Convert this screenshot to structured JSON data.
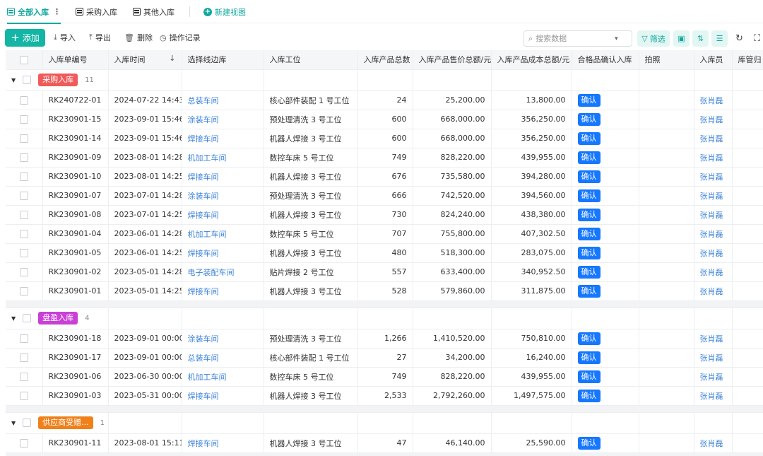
{
  "tabs": [
    {
      "label": "全部入库",
      "active": true
    },
    {
      "label": "采购入库",
      "active": false
    },
    {
      "label": "其他入库",
      "active": false
    }
  ],
  "new_view_label": "新建视图",
  "toolbar": {
    "add_label": "添加",
    "import_label": "导入",
    "export_label": "导出",
    "delete_label": "删除",
    "log_label": "操作记录",
    "search_placeholder": "搜索数据",
    "filter_label": "筛选"
  },
  "columns": [
    "入库单编号",
    "入库时间",
    "选择线边库",
    "入库工位",
    "入库产品总数",
    "入库产品售价总额/元",
    "入库产品成本总额/元",
    "合格品确认入库",
    "拍照",
    "入库员",
    "库管归"
  ],
  "confirm_label": "确认",
  "colors": {
    "accent": "#13a89e",
    "link": "#3b82d8",
    "confirm": "#1677ff"
  },
  "groups": [
    {
      "label": "采购入库",
      "color": "#f05a5a",
      "count": "11",
      "rows": [
        {
          "id": "RK240722-01",
          "time": "2024-07-22 14:43",
          "lib": "总装车间",
          "station": "核心部件装配 1 号工位",
          "qty": "24",
          "price": "25,200.00",
          "cost": "13,800.00",
          "staff": "张肖磊"
        },
        {
          "id": "RK230901-15",
          "time": "2023-09-01 15:46",
          "lib": "涂装车间",
          "station": "预处理清洗 3 号工位",
          "qty": "600",
          "price": "668,000.00",
          "cost": "356,250.00",
          "staff": "张肖磊"
        },
        {
          "id": "RK230901-14",
          "time": "2023-09-01 15:46",
          "lib": "焊接车间",
          "station": "机器人焊接 3 号工位",
          "qty": "600",
          "price": "668,000.00",
          "cost": "356,250.00",
          "staff": "张肖磊"
        },
        {
          "id": "RK230901-09",
          "time": "2023-08-01 14:28",
          "lib": "机加工车间",
          "station": "数控车床 5 号工位",
          "qty": "749",
          "price": "828,220.00",
          "cost": "439,955.00",
          "staff": "张肖磊"
        },
        {
          "id": "RK230901-10",
          "time": "2023-08-01 14:25",
          "lib": "焊接车间",
          "station": "机器人焊接 3 号工位",
          "qty": "676",
          "price": "735,580.00",
          "cost": "394,280.00",
          "staff": "张肖磊"
        },
        {
          "id": "RK230901-07",
          "time": "2023-07-01 14:28",
          "lib": "涂装车间",
          "station": "预处理清洗 3 号工位",
          "qty": "666",
          "price": "742,520.00",
          "cost": "394,560.00",
          "staff": "张肖磊"
        },
        {
          "id": "RK230901-08",
          "time": "2023-07-01 14:25",
          "lib": "焊接车间",
          "station": "机器人焊接 3 号工位",
          "qty": "730",
          "price": "824,240.00",
          "cost": "438,380.00",
          "staff": "张肖磊"
        },
        {
          "id": "RK230901-04",
          "time": "2023-06-01 14:28",
          "lib": "机加工车间",
          "station": "数控车床 5 号工位",
          "qty": "707",
          "price": "755,800.00",
          "cost": "407,302.50",
          "staff": "张肖磊"
        },
        {
          "id": "RK230901-05",
          "time": "2023-06-01 14:25",
          "lib": "焊接车间",
          "station": "机器人焊接 3 号工位",
          "qty": "480",
          "price": "518,300.00",
          "cost": "283,075.00",
          "staff": "张肖磊"
        },
        {
          "id": "RK230901-02",
          "time": "2023-05-01 14:28",
          "lib": "电子装配车间",
          "station": "贴片焊接 2 号工位",
          "qty": "557",
          "price": "633,400.00",
          "cost": "340,952.50",
          "staff": "张肖磊"
        },
        {
          "id": "RK230901-01",
          "time": "2023-05-01 14:25",
          "lib": "焊接车间",
          "station": "机器人焊接 3 号工位",
          "qty": "528",
          "price": "579,860.00",
          "cost": "311,875.00",
          "staff": "张肖磊"
        }
      ]
    },
    {
      "label": "盘盈入库",
      "color": "#c940d6",
      "count": "4",
      "rows": [
        {
          "id": "RK230901-18",
          "time": "2023-09-01 00:00",
          "lib": "涂装车间",
          "station": "预处理清洗 3 号工位",
          "qty": "1,266",
          "price": "1,410,520.00",
          "cost": "750,810.00",
          "staff": "张肖磊"
        },
        {
          "id": "RK230901-17",
          "time": "2023-09-01 00:00",
          "lib": "总装车间",
          "station": "核心部件装配 1 号工位",
          "qty": "27",
          "price": "34,200.00",
          "cost": "16,240.00",
          "staff": "张肖磊"
        },
        {
          "id": "RK230901-06",
          "time": "2023-06-30 00:00",
          "lib": "机加工车间",
          "station": "数控车床 5 号工位",
          "qty": "749",
          "price": "828,220.00",
          "cost": "439,955.00",
          "staff": "张肖磊"
        },
        {
          "id": "RK230901-03",
          "time": "2023-05-31 00:00",
          "lib": "焊接车间",
          "station": "机器人焊接 3 号工位",
          "qty": "2,533",
          "price": "2,792,260.00",
          "cost": "1,497,575.00",
          "staff": "张肖磊"
        }
      ]
    },
    {
      "label": "供应商受赠...",
      "color": "#f0801a",
      "count": "1",
      "rows": [
        {
          "id": "RK230901-11",
          "time": "2023-08-01 15:11",
          "lib": "焊接车间",
          "station": "机器人焊接 3 号工位",
          "qty": "47",
          "price": "46,140.00",
          "cost": "25,590.00",
          "staff": "张肖磊"
        }
      ]
    }
  ]
}
